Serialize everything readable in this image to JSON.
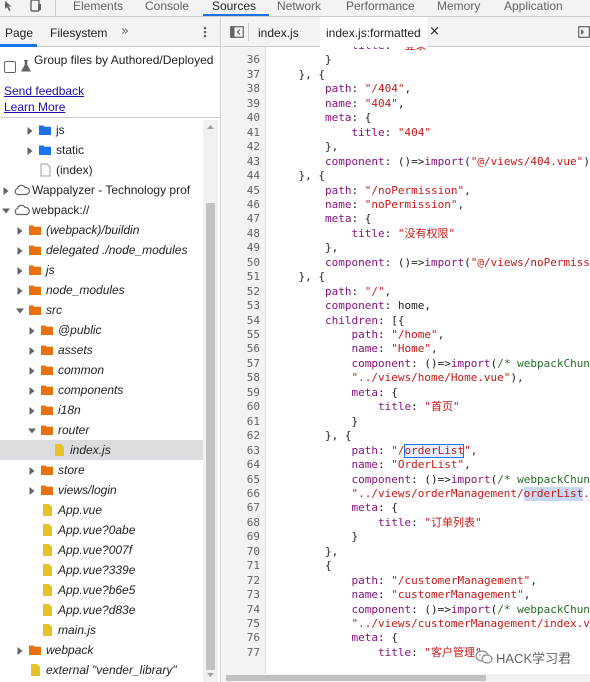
{
  "topbar": {
    "tabs": [
      "Elements",
      "Console",
      "Sources",
      "Network",
      "Performance",
      "Memory",
      "Application"
    ],
    "active_tab": "Sources"
  },
  "sidebar": {
    "tabs": [
      "Page",
      "Filesystem"
    ],
    "more": "»",
    "group_label": "Group files by Authored/Deployed",
    "send_feedback": "Send feedback",
    "learn_more": "Learn More",
    "tree": [
      {
        "label": "js",
        "icon": "folder-blue",
        "italic": false
      },
      {
        "label": "static",
        "icon": "folder-blue",
        "italic": false
      },
      {
        "label": "(index)",
        "icon": "file-gray",
        "italic": false
      },
      {
        "label": "Wappalyzer - Technology prof",
        "icon": "cloud",
        "italic": false
      },
      {
        "label": "webpack://",
        "icon": "cloud",
        "italic": false
      },
      {
        "label": "(webpack)/buildin",
        "icon": "folder-orange",
        "italic": true
      },
      {
        "label": "delegated ./node_modules",
        "icon": "folder-orange",
        "italic": true
      },
      {
        "label": "js",
        "icon": "folder-orange",
        "italic": true
      },
      {
        "label": "node_modules",
        "icon": "folder-orange",
        "italic": true
      },
      {
        "label": "src",
        "icon": "folder-orange",
        "italic": true
      },
      {
        "label": "@public",
        "icon": "folder-orange",
        "italic": true
      },
      {
        "label": "assets",
        "icon": "folder-orange",
        "italic": true
      },
      {
        "label": "common",
        "icon": "folder-orange",
        "italic": true
      },
      {
        "label": "components",
        "icon": "folder-orange",
        "italic": true
      },
      {
        "label": "i18n",
        "icon": "folder-orange",
        "italic": true
      },
      {
        "label": "router",
        "icon": "folder-orange",
        "italic": true
      },
      {
        "label": "index.js",
        "icon": "file-yellow",
        "italic": true
      },
      {
        "label": "store",
        "icon": "folder-orange",
        "italic": true
      },
      {
        "label": "views/login",
        "icon": "folder-orange",
        "italic": true
      },
      {
        "label": "App.vue",
        "icon": "file-yellow",
        "italic": true
      },
      {
        "label": "App.vue?0abe",
        "icon": "file-yellow",
        "italic": true
      },
      {
        "label": "App.vue?007f",
        "icon": "file-yellow",
        "italic": true
      },
      {
        "label": "App.vue?339e",
        "icon": "file-yellow",
        "italic": true
      },
      {
        "label": "App.vue?b6e5",
        "icon": "file-yellow",
        "italic": true
      },
      {
        "label": "App.vue?d83e",
        "icon": "file-yellow",
        "italic": true
      },
      {
        "label": "main.js",
        "icon": "file-yellow",
        "italic": true
      },
      {
        "label": "webpack",
        "icon": "folder-orange",
        "italic": true
      },
      {
        "label": "external \"vender_library\"",
        "icon": "file-yellow",
        "italic": true
      }
    ]
  },
  "editor": {
    "tabs": [
      {
        "label": "index.js",
        "active": false
      },
      {
        "label": "index.js:formatted",
        "active": true
      }
    ],
    "close": "×",
    "lines": [
      {
        "n": "",
        "html": "            title: \"登录\""
      },
      {
        "n": "36",
        "html": "        }"
      },
      {
        "n": "37",
        "html": "    }, {"
      },
      {
        "n": "38",
        "html": "        path: \"/404\","
      },
      {
        "n": "39",
        "html": "        name: \"404\","
      },
      {
        "n": "40",
        "html": "        meta: {"
      },
      {
        "n": "41",
        "html": "            title: \"404\""
      },
      {
        "n": "42",
        "html": "        },"
      },
      {
        "n": "43",
        "html": "        component: ()=>import(\"@/views/404.vue\")"
      },
      {
        "n": "44",
        "html": "    }, {"
      },
      {
        "n": "45",
        "html": "        path: \"/noPermission\","
      },
      {
        "n": "46",
        "html": "        name: \"noPermission\","
      },
      {
        "n": "47",
        "html": "        meta: {"
      },
      {
        "n": "48",
        "html": "            title: \"没有权限\""
      },
      {
        "n": "49",
        "html": "        },"
      },
      {
        "n": "50",
        "html": "        component: ()=>import(\"@/views/noPermission.v"
      },
      {
        "n": "51",
        "html": "    }, {"
      },
      {
        "n": "52",
        "html": "        path: \"/\","
      },
      {
        "n": "53",
        "html": "        component: home,"
      },
      {
        "n": "54",
        "html": "        children: [{"
      },
      {
        "n": "55",
        "html": "            path: \"/home\","
      },
      {
        "n": "56",
        "html": "            name: \"Home\","
      },
      {
        "n": "57",
        "html": "            component: ()=>import(/* webpackChunkName"
      },
      {
        "n": "58",
        "html": "            \"../views/home/Home.vue\"),"
      },
      {
        "n": "59",
        "html": "            meta: {"
      },
      {
        "n": "60",
        "html": "                title: \"首页\""
      },
      {
        "n": "61",
        "html": "            }"
      },
      {
        "n": "62",
        "html": "        }, {"
      },
      {
        "n": "63",
        "html": "            path: \"/orderList\","
      },
      {
        "n": "64",
        "html": "            name: \"OrderList\","
      },
      {
        "n": "65",
        "html": "            component: ()=>import(/* webpackChunkName"
      },
      {
        "n": "66",
        "html": "            \"../views/orderManagement/orderList.vue\")"
      },
      {
        "n": "67",
        "html": "            meta: {"
      },
      {
        "n": "68",
        "html": "                title: \"订单列表\""
      },
      {
        "n": "69",
        "html": "            }"
      },
      {
        "n": "70",
        "html": "        },"
      },
      {
        "n": "71",
        "html": "        {"
      },
      {
        "n": "72",
        "html": "            path: \"/customerManagement\","
      },
      {
        "n": "73",
        "html": "            name: \"customerManagement\","
      },
      {
        "n": "74",
        "html": "            component: ()=>import(/* webpackChunkName"
      },
      {
        "n": "75",
        "html": "            \"../views/customerManagement/index.vue\"),"
      },
      {
        "n": "76",
        "html": "            meta: {"
      },
      {
        "n": "77",
        "html": "                title: \"客户管理\""
      }
    ]
  },
  "watermark": "HACK学习君",
  "colors": {
    "accent": "#1a73e8",
    "folder_orange": "#e8710a",
    "folder_blue": "#1a73e8",
    "file_yellow": "#e6c229",
    "string": "#c41a16",
    "keyword": "#881280",
    "comment": "#236e25"
  }
}
